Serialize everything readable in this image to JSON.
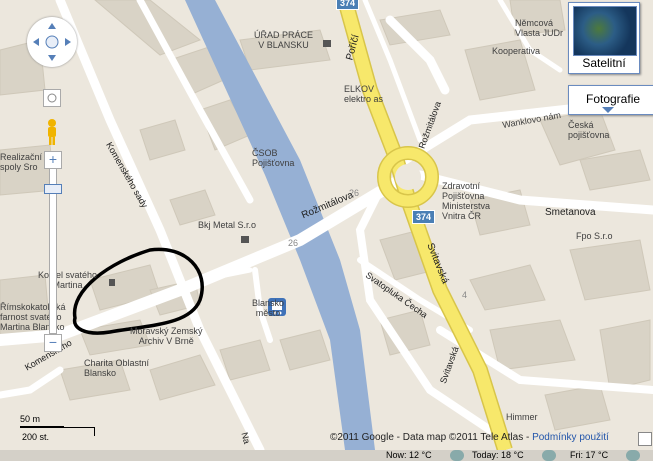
{
  "map": {
    "place_labels": [
      {
        "key": "urad",
        "text": "ÚŘAD PRÁCE\nV BLANSKU"
      },
      {
        "key": "nemcova",
        "text": "Němcová\nVlasta JUDr"
      },
      {
        "key": "koop",
        "text": "Kooperativa"
      },
      {
        "key": "elkov",
        "text": "ELKOV\nelektro as"
      },
      {
        "key": "wanklovo",
        "text": "Wanklovo nám"
      },
      {
        "key": "ceska",
        "text": "Česká\npojišťovna"
      },
      {
        "key": "csob",
        "text": "ČSOB\nPojišťovna"
      },
      {
        "key": "zdrav",
        "text": "Zdravotní\nPojišťovna\nMinisterstva\nVnitra ČR"
      },
      {
        "key": "bkj",
        "text": "Bkj Metal S.r.o"
      },
      {
        "key": "fpo",
        "text": "Fpo S.r.o"
      },
      {
        "key": "kostel",
        "text": "Kostel svatého\nMartina"
      },
      {
        "key": "rimsko",
        "text": "Římskokatolická\nfarnost svatého\nMartina Blansko"
      },
      {
        "key": "realiz",
        "text": "Realizační\nspoly Sro"
      },
      {
        "key": "blansko_mesto",
        "text": "Blansko\nměsto"
      },
      {
        "key": "zemsky",
        "text": "Moravský Zemský\nArchiv V Brně"
      },
      {
        "key": "charita",
        "text": "Charita Oblastní\nBlansko"
      },
      {
        "key": "himmer",
        "text": "Himmer"
      }
    ],
    "street_labels": {
      "porici": "Poříčí",
      "rozmitalova_top": "Rožmitálova",
      "rozmitalova_left": "Rožmitálova",
      "smetanova": "Smetanova",
      "svitavska": "Svitavská",
      "svatopluka": "Svatopluka Čecha",
      "svitavska2": "Svitavská",
      "komenskeho_sady": "Komenského sady",
      "komenskeho": "Komenského",
      "na": "Na"
    },
    "road_shields": {
      "top": "374",
      "mid": "374"
    },
    "house_numbers": {
      "a": "26",
      "b": "26",
      "c": "4"
    }
  },
  "controls": {
    "satellite_label": "Satelitní",
    "photo_label": "Fotografie",
    "zoom_in": "+",
    "zoom_out": "−"
  },
  "scale": {
    "metric": "50 m",
    "imperial": "200 st."
  },
  "copyright": {
    "text": "©2011 Google - Data map ©2011 Tele Atlas - ",
    "link": "Podmínky použití"
  },
  "status": {
    "now": "Now: 12 °C",
    "today": "Today: 18 °C",
    "fri": "Fri: 17 °C"
  },
  "colors": {
    "main_road": "#f7e86b",
    "main_road_border": "#d8c54a",
    "river": "#96b0d4",
    "building": "#d9d3c6",
    "background": "#ece7dd",
    "road": "#ffffff"
  }
}
